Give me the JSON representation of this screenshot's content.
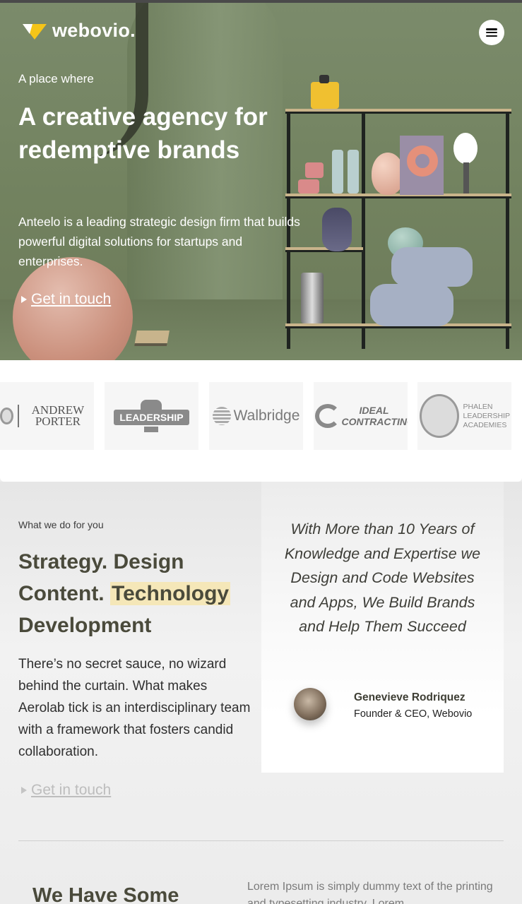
{
  "brand": {
    "name": "webovio."
  },
  "hero": {
    "eyebrow": "A place where",
    "headline": "A creative agency for redemptive brands",
    "intro": "Anteelo is a leading strategic design firm that builds powerful digital solutions for startups and enterprises.",
    "cta_label": "Get in touch"
  },
  "clients": [
    {
      "name": "ANDREW PORTER"
    },
    {
      "name": "LEADERSHIP"
    },
    {
      "name": "Walbridge"
    },
    {
      "name": "IDEAL CONTRACTING"
    },
    {
      "name": "PHALEN LEADERSHIP ACADEMIES"
    }
  ],
  "services": {
    "eyebrow": "What we do for you",
    "title_part1": "Strategy. Design Content. ",
    "title_highlight": "Technology",
    "title_part2": " Development",
    "body": "There’s no secret sauce, no wizard behind the curtain. What makes Aerolab tick is an interdisciplinary team with a framework that fosters candid collaboration.",
    "cta_label": "Get in touch"
  },
  "testimonial": {
    "quote": "With More than 10 Years of Knowledge and Expertise we Design and Code Websites and Apps, We Build Brands and Help Them Succeed",
    "author_name": "Genevieve Rodriquez",
    "author_role": "Founder & CEO, Webovio"
  },
  "next_section": {
    "title": "We Have Some",
    "text": "Lorem Ipsum is simply dummy text of the printing and typesetting industry. Lorem"
  },
  "colors": {
    "accent_yellow": "#f5c518",
    "highlight": "#f5e7b8",
    "heading_olive": "#4a4a3b",
    "hero_green": "#75855f"
  },
  "icons": {
    "menu": "hamburger-icon",
    "cta": "play-triangle-icon"
  }
}
